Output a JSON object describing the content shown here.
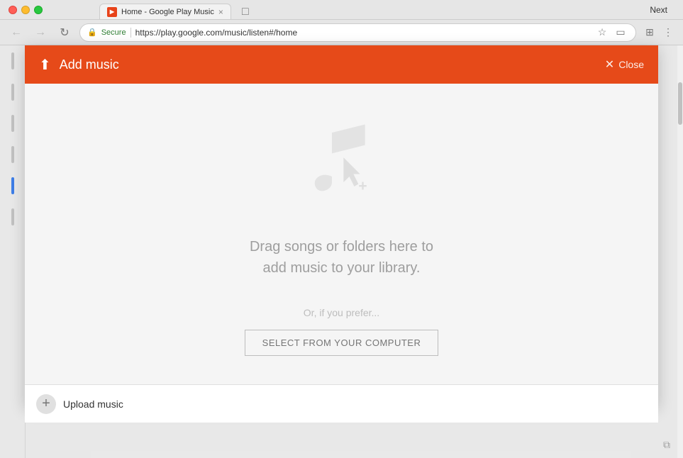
{
  "browser": {
    "tab_title": "Home - Google Play Music",
    "tab_close": "×",
    "next_label": "Next",
    "nav_back": "←",
    "nav_forward": "→",
    "nav_refresh": "↺",
    "secure_label": "Secure",
    "url": "https://play.google.com/music/listen#/home",
    "toolbar_icons": [
      "bookmark",
      "star",
      "cast",
      "puzzle",
      "more"
    ]
  },
  "modal": {
    "title": "Add music",
    "close_label": "Close",
    "upload_icon": "⬆",
    "drag_text_line1": "Drag songs or folders here to",
    "drag_text_line2": "add music to your library.",
    "or_text": "Or, if you prefer...",
    "select_button": "SELECT FROM YOUR COMPUTER"
  },
  "bottom_bar": {
    "add_icon": "+",
    "label": "Upload music"
  }
}
